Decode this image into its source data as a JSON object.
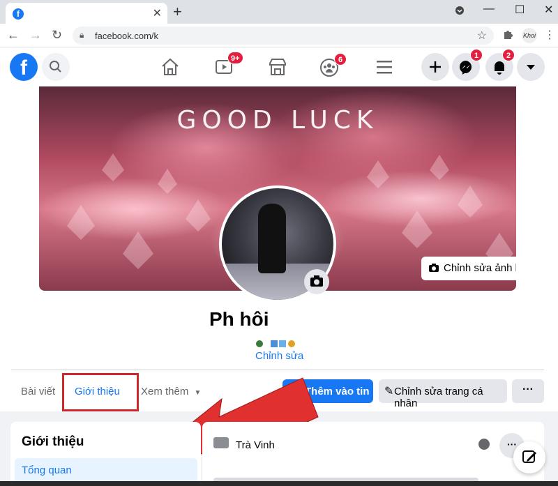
{
  "browser": {
    "url": "facebook.com/k",
    "profile_label": "Khoi"
  },
  "header": {
    "logo_letter": "f",
    "video_badge": "9+",
    "groups_badge": "6",
    "messenger_badge": "1",
    "notifications_badge": "2"
  },
  "cover": {
    "title": "GOOD LUCK",
    "edit_label": "Chỉnh sửa ảnh bìa"
  },
  "profile": {
    "name": "Ph         hôi",
    "edit_bio_label": "Chỉnh sửa"
  },
  "tabs": {
    "posts": "Bài viết",
    "about": "Giới thiệu",
    "more": "Xem thêm"
  },
  "actions": {
    "add_story": "Thêm vào tin",
    "edit_profile": "Chỉnh sửa trang cá nhân",
    "more": "···"
  },
  "about_card": {
    "title": "Giới thiệu",
    "overview": "Tổng quan"
  },
  "detail_card": {
    "row1": "Trà Vinh",
    "row_more": "···"
  },
  "colors": {
    "accent": "#1877f2",
    "highlight_box": "#d0262a",
    "arrow": "#e03030"
  }
}
